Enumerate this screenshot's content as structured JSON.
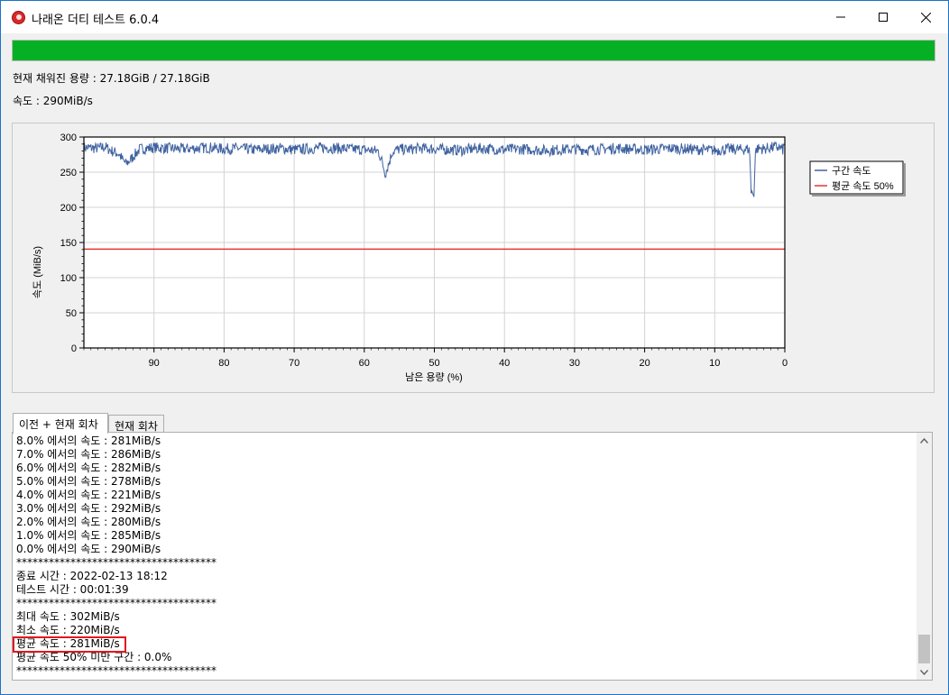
{
  "window": {
    "title": "나래온 더티 테스트 6.0.4",
    "icons": {
      "app": "app-logo-icon",
      "minimize": "minimize-icon",
      "maximize": "maximize-icon",
      "close": "close-icon"
    }
  },
  "progress": {
    "fraction": 1.0,
    "color": "#06b025"
  },
  "status": {
    "filled": "현재 채워진 용량 : 27.18GiB / 27.18GiB",
    "speed": "속도 : 290MiB/s"
  },
  "chart_data": {
    "type": "line",
    "ylabel": "속도 (MiB/s)",
    "xlabel": "남은 용량 (%)",
    "ylim": [
      0,
      300
    ],
    "xlim": [
      100,
      0
    ],
    "x_reversed": true,
    "y_ticks": [
      "0",
      "50",
      "100",
      "150",
      "200",
      "250",
      "300"
    ],
    "x_ticks": [
      "90",
      "80",
      "70",
      "60",
      "50",
      "40",
      "30",
      "20",
      "10",
      "0"
    ],
    "grid": true,
    "legend_position": "right",
    "series": [
      {
        "name": "구간 속도",
        "color": "#3f62a0",
        "x": [
          100,
          98,
          97,
          96,
          95,
          94.5,
          94,
          93.5,
          93,
          92,
          91,
          90,
          88,
          86,
          84,
          82,
          80,
          78,
          76,
          74,
          72,
          70,
          68,
          66,
          64,
          62,
          60,
          59,
          58,
          57.5,
          57,
          56.5,
          56,
          55,
          54,
          52,
          50,
          48,
          46,
          44,
          42,
          40,
          38,
          36,
          34,
          32,
          30,
          28,
          26,
          24,
          22,
          20,
          18,
          16,
          14,
          12,
          10,
          8,
          6,
          5.2,
          5,
          4.8,
          4.6,
          4.4,
          4.2,
          4,
          3.5,
          3,
          2,
          1,
          0.3,
          0
        ],
        "values": [
          285,
          284,
          286,
          280,
          276,
          268,
          262,
          266,
          272,
          283,
          284,
          285,
          284,
          283,
          284,
          285,
          283,
          284,
          282,
          283,
          284,
          282,
          283,
          285,
          284,
          283,
          282,
          281,
          280,
          266,
          248,
          262,
          279,
          283,
          282,
          284,
          283,
          282,
          281,
          284,
          283,
          282,
          283,
          282,
          281,
          282,
          283,
          282,
          283,
          284,
          283,
          282,
          283,
          284,
          283,
          282,
          281,
          283,
          282,
          283,
          278,
          221,
          220,
          221,
          278,
          283,
          284,
          283,
          285,
          286,
          282,
          290
        ]
      },
      {
        "name": "평균 속도 50%",
        "color": "#e8342f",
        "x": [
          100,
          0
        ],
        "values": [
          140.5,
          140.5
        ]
      }
    ]
  },
  "tabs": [
    {
      "label": "이전 + 현재 회차",
      "active": true
    },
    {
      "label": "현재 회차",
      "active": false
    }
  ],
  "log": [
    "8.0% 에서의 속도 : 281MiB/s",
    "7.0% 에서의 속도 : 286MiB/s",
    "6.0% 에서의 속도 : 282MiB/s",
    "5.0% 에서의 속도 : 278MiB/s",
    "4.0% 에서의 속도 : 221MiB/s",
    "3.0% 에서의 속도 : 292MiB/s",
    "2.0% 에서의 속도 : 280MiB/s",
    "1.0% 에서의 속도 : 285MiB/s",
    "0.0% 에서의 속도 : 290MiB/s",
    "*************************************",
    "종료 시간 : 2022-02-13 18:12",
    "테스트 시간 : 00:01:39",
    "*************************************",
    "최대 속도 : 302MiB/s",
    "최소 속도 : 220MiB/s",
    "평균 속도 : 281MiB/s",
    "평균 속도 50% 미만 구간 : 0.0%",
    "*************************************"
  ],
  "highlight": {
    "color": "#e0181f",
    "line_text": "평균 속도 : 281MiB/s"
  }
}
